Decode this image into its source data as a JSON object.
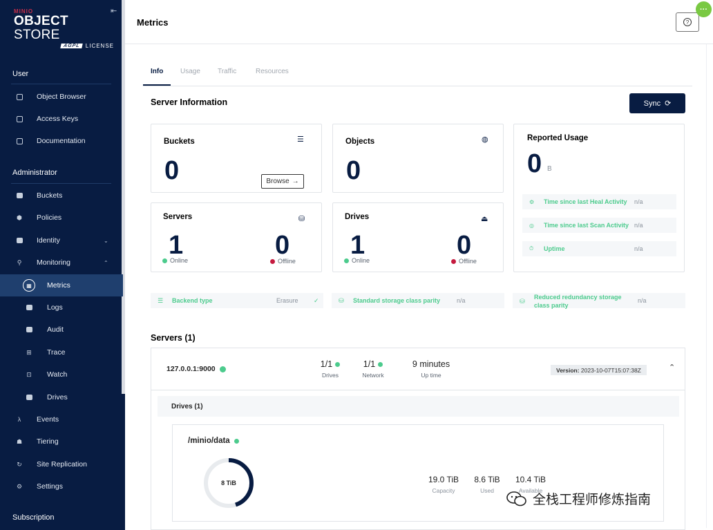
{
  "brand": {
    "vendor": "MINIO",
    "product_bold": "OBJECT",
    "product_light": "STORE",
    "license_badge": "AGPL",
    "license_text": "LICENSE"
  },
  "sidebar": {
    "section_user": "User",
    "user_items": [
      {
        "label": "Object Browser",
        "icon": "folder-icon"
      },
      {
        "label": "Access Keys",
        "icon": "key-icon"
      },
      {
        "label": "Documentation",
        "icon": "book-icon"
      }
    ],
    "section_admin": "Administrator",
    "admin_items": [
      {
        "label": "Buckets",
        "icon": "bucket-icon"
      },
      {
        "label": "Policies",
        "icon": "shield-icon"
      },
      {
        "label": "Identity",
        "icon": "id-card-icon"
      },
      {
        "label": "Monitoring",
        "icon": "magnifier-icon"
      }
    ],
    "monitoring_items": [
      {
        "label": "Metrics",
        "icon": "metrics-icon"
      },
      {
        "label": "Logs",
        "icon": "logs-icon"
      },
      {
        "label": "Audit",
        "icon": "audit-icon"
      },
      {
        "label": "Trace",
        "icon": "trace-icon"
      },
      {
        "label": "Watch",
        "icon": "watch-icon"
      },
      {
        "label": "Drives",
        "icon": "drive-icon"
      }
    ],
    "rest_items": [
      {
        "label": "Events",
        "icon": "lambda-icon",
        "glyph": "λ"
      },
      {
        "label": "Tiering",
        "icon": "tiering-icon"
      },
      {
        "label": "Site Replication",
        "icon": "replication-icon"
      },
      {
        "label": "Settings",
        "icon": "gear-icon"
      }
    ],
    "section_subscription": "Subscription"
  },
  "header": {
    "title": "Metrics",
    "corner_badge": "···"
  },
  "tabs": [
    "Info",
    "Usage",
    "Traffic",
    "Resources"
  ],
  "server_info": {
    "title": "Server Information",
    "sync_label": "Sync",
    "buckets": {
      "label": "Buckets",
      "value": "0",
      "browse_label": "Browse"
    },
    "objects": {
      "label": "Objects",
      "value": "0"
    },
    "reported_usage": {
      "label": "Reported Usage",
      "value": "0",
      "unit": "B"
    },
    "servers": {
      "label": "Servers",
      "online": "1",
      "offline": "0",
      "online_label": "Online",
      "offline_label": "Offline"
    },
    "drives": {
      "label": "Drives",
      "online": "1",
      "offline": "0",
      "online_label": "Online",
      "offline_label": "Offline"
    },
    "usage_rows": [
      {
        "label": "Time since last Heal Activity",
        "value": "n/a"
      },
      {
        "label": "Time since last Scan Activity",
        "value": "n/a"
      },
      {
        "label": "Uptime",
        "value": "n/a"
      }
    ],
    "backend": {
      "label": "Backend type",
      "value": "Erasure"
    },
    "standard_parity": {
      "label": "Standard storage class parity",
      "value": "n/a"
    },
    "rr_parity": {
      "label_line1": "Reduced redundancy storage",
      "label_line2": "class parity",
      "value": "n/a"
    }
  },
  "servers_section": {
    "title": "Servers (1)",
    "server": {
      "address": "127.0.0.1:9000",
      "drives_value": "1/1",
      "drives_label": "Drives",
      "network_value": "1/1",
      "network_label": "Network",
      "uptime_value": "9 minutes",
      "uptime_label": "Up time",
      "version_label": "Version:",
      "version_value": "2023-10-07T15:07:38Z"
    },
    "drives_title": "Drives (1)",
    "drive": {
      "path": "/minio/data",
      "donut_label": "8 TiB",
      "used_fraction": 0.45,
      "capacity_value": "19.0 TiB",
      "capacity_label": "Capacity",
      "used_value": "8.6 TiB",
      "used_label": "Used",
      "available_value": "10.4 TiB",
      "available_label": "Available"
    }
  },
  "watermark": {
    "text": "全栈工程师修炼指南"
  },
  "colors": {
    "navy": "#081c42",
    "green": "#4ccb8d",
    "red": "#c51b3f"
  }
}
